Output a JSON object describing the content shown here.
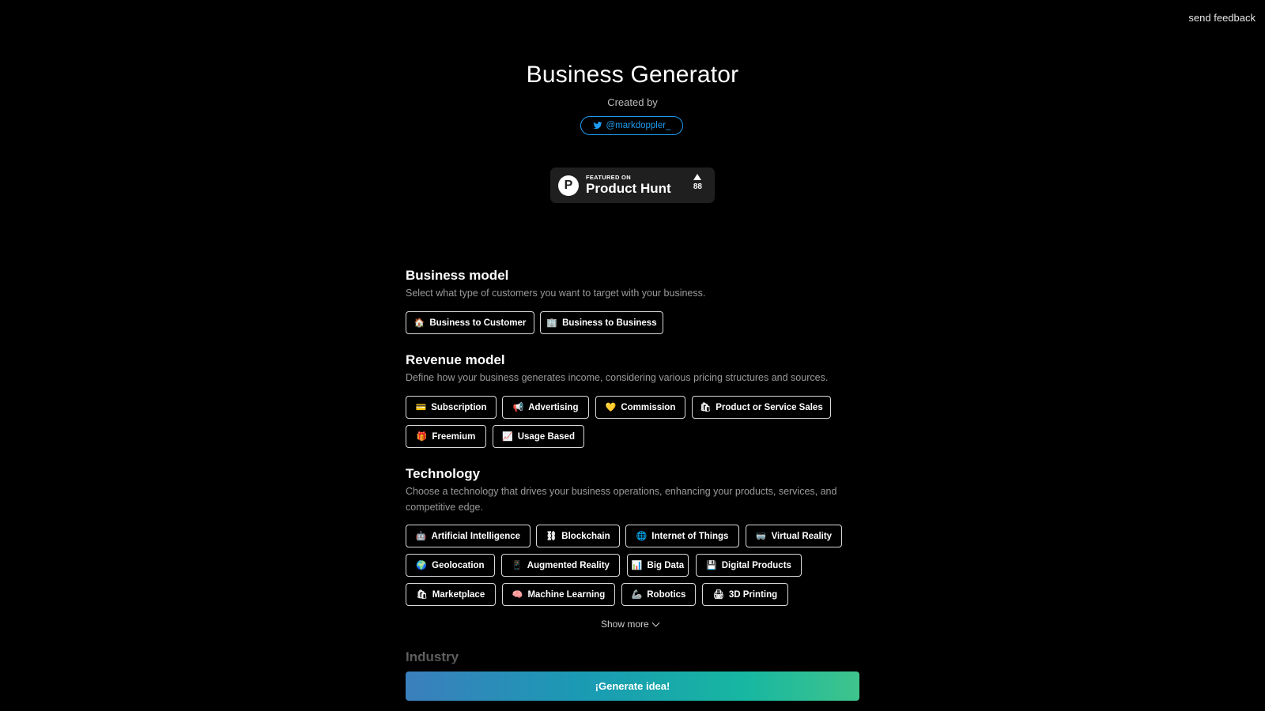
{
  "header": {
    "feedback_label": "send feedback"
  },
  "hero": {
    "title": "Business Generator",
    "created_by": "Created by",
    "twitter_handle": "@markdoppler_",
    "product_hunt": {
      "featured_on": "FEATURED ON",
      "name": "Product Hunt",
      "votes": "88"
    }
  },
  "sections": {
    "business_model": {
      "title": "Business model",
      "description": "Select what type of customers you want to target with your business.",
      "options": [
        {
          "emoji": "🏠",
          "label": "Business to Customer"
        },
        {
          "emoji": "🏢",
          "label": "Business to Business"
        }
      ]
    },
    "revenue_model": {
      "title": "Revenue model",
      "description": "Define how your business generates income, considering various pricing structures and sources.",
      "options": [
        {
          "emoji": "💳",
          "label": "Subscription"
        },
        {
          "emoji": "📢",
          "label": "Advertising"
        },
        {
          "emoji": "💛",
          "label": "Commission"
        },
        {
          "emoji": "🛍",
          "label": "Product or Service Sales"
        },
        {
          "emoji": "🎁",
          "label": "Freemium"
        },
        {
          "emoji": "📈",
          "label": "Usage Based"
        }
      ]
    },
    "technology": {
      "title": "Technology",
      "description": "Choose a technology that drives your business operations, enhancing your products, services, and competitive edge.",
      "options": [
        {
          "emoji": "🤖",
          "label": "Artificial Intelligence"
        },
        {
          "emoji": "⛓",
          "label": "Blockchain"
        },
        {
          "emoji": "🌐",
          "label": "Internet of Things"
        },
        {
          "emoji": "🥽",
          "label": "Virtual Reality"
        },
        {
          "emoji": "🌍",
          "label": "Geolocation"
        },
        {
          "emoji": "📱",
          "label": "Augmented Reality"
        },
        {
          "emoji": "📊",
          "label": "Big Data"
        },
        {
          "emoji": "💾",
          "label": "Digital Products"
        },
        {
          "emoji": "🛍",
          "label": "Marketplace"
        },
        {
          "emoji": "🧠",
          "label": "Machine Learning"
        },
        {
          "emoji": "🦾",
          "label": "Robotics"
        },
        {
          "emoji": "🖨",
          "label": "3D Printing"
        }
      ],
      "show_more_label": "Show more"
    },
    "industry": {
      "title": "Industry"
    }
  },
  "generate_button_label": "¡Generate idea!"
}
